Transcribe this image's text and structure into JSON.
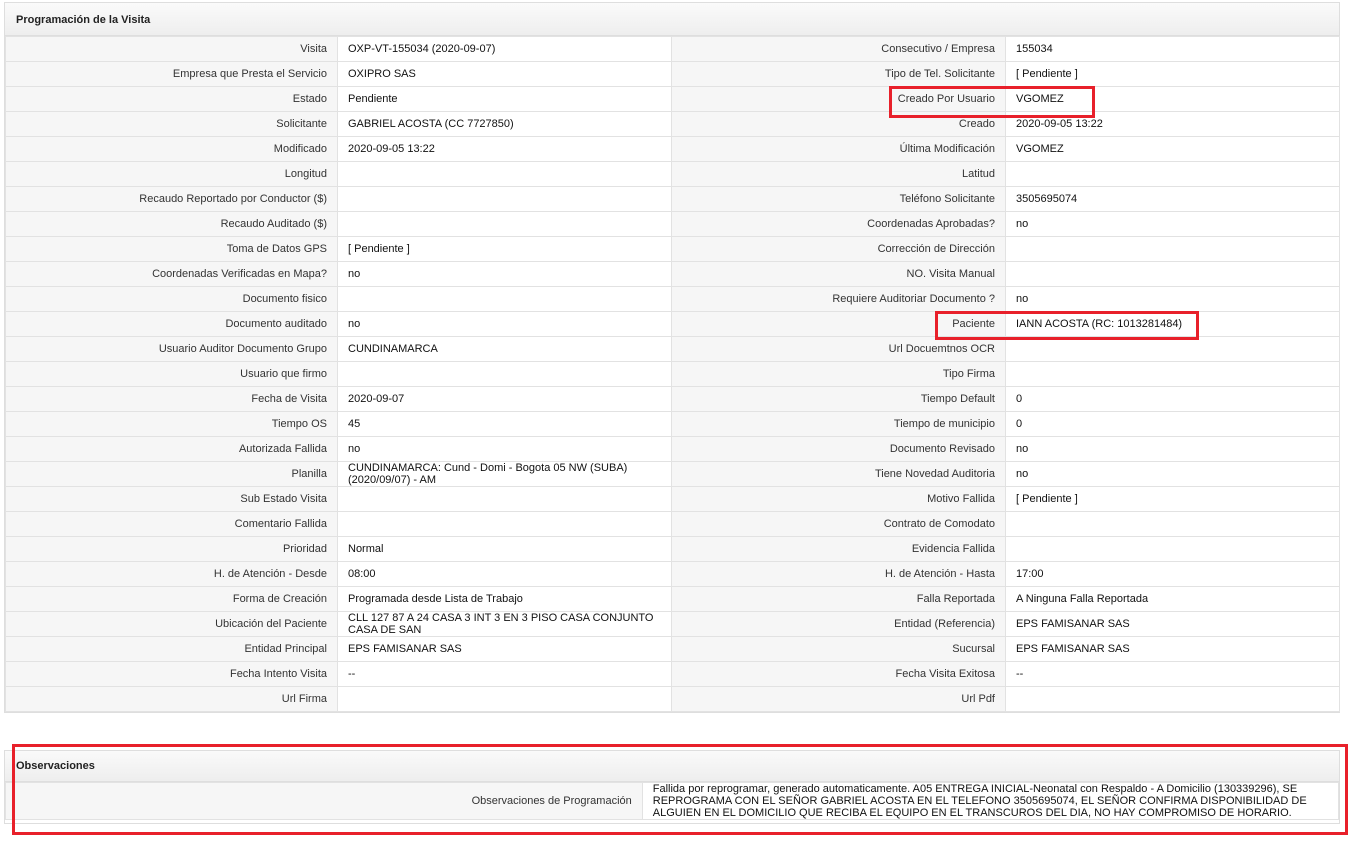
{
  "programacion": {
    "title": "Programación de la Visita",
    "rows": [
      [
        {
          "label": "Visita",
          "value": "OXP-VT-155034 (2020-09-07)"
        },
        {
          "label": "Consecutivo / Empresa",
          "value": "155034"
        }
      ],
      [
        {
          "label": "Empresa que Presta el Servicio",
          "value": "OXIPRO SAS"
        },
        {
          "label": "Tipo de Tel. Solicitante",
          "value": "[ Pendiente ]"
        }
      ],
      [
        {
          "label": "Estado",
          "value": "Pendiente"
        },
        {
          "label": "Creado Por Usuario",
          "value": "VGOMEZ"
        }
      ],
      [
        {
          "label": "Solicitante",
          "value": "GABRIEL ACOSTA (CC 7727850)"
        },
        {
          "label": "Creado",
          "value": "2020-09-05 13:22"
        }
      ],
      [
        {
          "label": "Modificado",
          "value": "2020-09-05 13:22"
        },
        {
          "label": "Última Modificación",
          "value": " VGOMEZ"
        }
      ],
      [
        {
          "label": "Longitud",
          "value": ""
        },
        {
          "label": "Latitud",
          "value": ""
        }
      ],
      [
        {
          "label": "Recaudo Reportado por Conductor ($)",
          "value": ""
        },
        {
          "label": "Teléfono Solicitante",
          "value": "3505695074"
        }
      ],
      [
        {
          "label": "Recaudo Auditado ($)",
          "value": ""
        },
        {
          "label": "Coordenadas Aprobadas?",
          "value": " no"
        }
      ],
      [
        {
          "label": "Toma de Datos GPS",
          "value": "[ Pendiente ]"
        },
        {
          "label": "Corrección de Dirección",
          "value": ""
        }
      ],
      [
        {
          "label": "Coordenadas Verificadas en Mapa?",
          "value": " no"
        },
        {
          "label": "NO. Visita Manual",
          "value": ""
        }
      ],
      [
        {
          "label": "Documento fisico",
          "value": ""
        },
        {
          "label": "Requiere Auditoriar Documento ?",
          "value": " no"
        }
      ],
      [
        {
          "label": "Documento auditado",
          "value": " no"
        },
        {
          "label": "Paciente",
          "value": "IANN ACOSTA (RC: 1013281484)"
        }
      ],
      [
        {
          "label": "Usuario Auditor Documento Grupo",
          "value": "CUNDINAMARCA"
        },
        {
          "label": "Url Docuemtnos OCR",
          "value": ""
        }
      ],
      [
        {
          "label": "Usuario que firmo",
          "value": ""
        },
        {
          "label": "Tipo Firma",
          "value": ""
        }
      ],
      [
        {
          "label": "Fecha de Visita",
          "value": " 2020-09-07"
        },
        {
          "label": "Tiempo Default",
          "value": "0"
        }
      ],
      [
        {
          "label": "Tiempo OS",
          "value": "45"
        },
        {
          "label": "Tiempo de municipio",
          "value": "0"
        }
      ],
      [
        {
          "label": "Autorizada Fallida",
          "value": " no"
        },
        {
          "label": "Documento Revisado",
          "value": " no"
        }
      ],
      [
        {
          "label": "Planilla",
          "value": "CUNDINAMARCA: Cund - Domi - Bogota 05 NW (SUBA) (2020/09/07) - AM"
        },
        {
          "label": "Tiene Novedad Auditoria",
          "value": " no"
        }
      ],
      [
        {
          "label": "Sub Estado Visita",
          "value": ""
        },
        {
          "label": "Motivo Fallida",
          "value": "[ Pendiente ]"
        }
      ],
      [
        {
          "label": "Comentario Fallida",
          "value": ""
        },
        {
          "label": "Contrato de Comodato",
          "value": ""
        }
      ],
      [
        {
          "label": "Prioridad",
          "value": "Normal"
        },
        {
          "label": "Evidencia Fallida",
          "value": ""
        }
      ],
      [
        {
          "label": "H. de Atención - Desde",
          "value": "08:00"
        },
        {
          "label": "H. de Atención - Hasta",
          "value": "17:00"
        }
      ],
      [
        {
          "label": "Forma de Creación",
          "value": "Programada desde Lista de Trabajo"
        },
        {
          "label": "Falla Reportada",
          "value": "A Ninguna Falla Reportada"
        }
      ],
      [
        {
          "label": "Ubicación del Paciente",
          "value": "CLL 127 87 A 24 CASA 3 INT 3 EN 3 PISO CASA CONJUNTO CASA DE SAN"
        },
        {
          "label": "Entidad (Referencia)",
          "value": "EPS FAMISANAR SAS"
        }
      ],
      [
        {
          "label": "Entidad Principal",
          "value": "EPS FAMISANAR SAS"
        },
        {
          "label": "Sucursal",
          "value": "EPS FAMISANAR SAS"
        }
      ],
      [
        {
          "label": "Fecha Intento Visita",
          "value": " --"
        },
        {
          "label": "Fecha Visita Exitosa",
          "value": " --"
        }
      ],
      [
        {
          "label": "Url Firma",
          "value": ""
        },
        {
          "label": "Url Pdf",
          "value": ""
        }
      ]
    ]
  },
  "observaciones": {
    "title": "Observaciones",
    "label": "Observaciones de Programación",
    "value": "   Fallida por reprogramar, generado automaticamente. A05 ENTREGA INICIAL-Neonatal con Respaldo - A Domicilio (130339296), SE REPROGRAMA CON EL SEÑOR GABRIEL ACOSTA EN EL TELEFONO 3505695074, EL SEÑOR CONFIRMA DISPONIBILIDAD DE ALGUIEN EN EL DOMICILIO QUE RECIBA EL EQUIPO EN EL TRANSCUROS DEL DIA, NO HAY COMPROMISO DE HORARIO."
  },
  "highlight_color": "#e8202a"
}
